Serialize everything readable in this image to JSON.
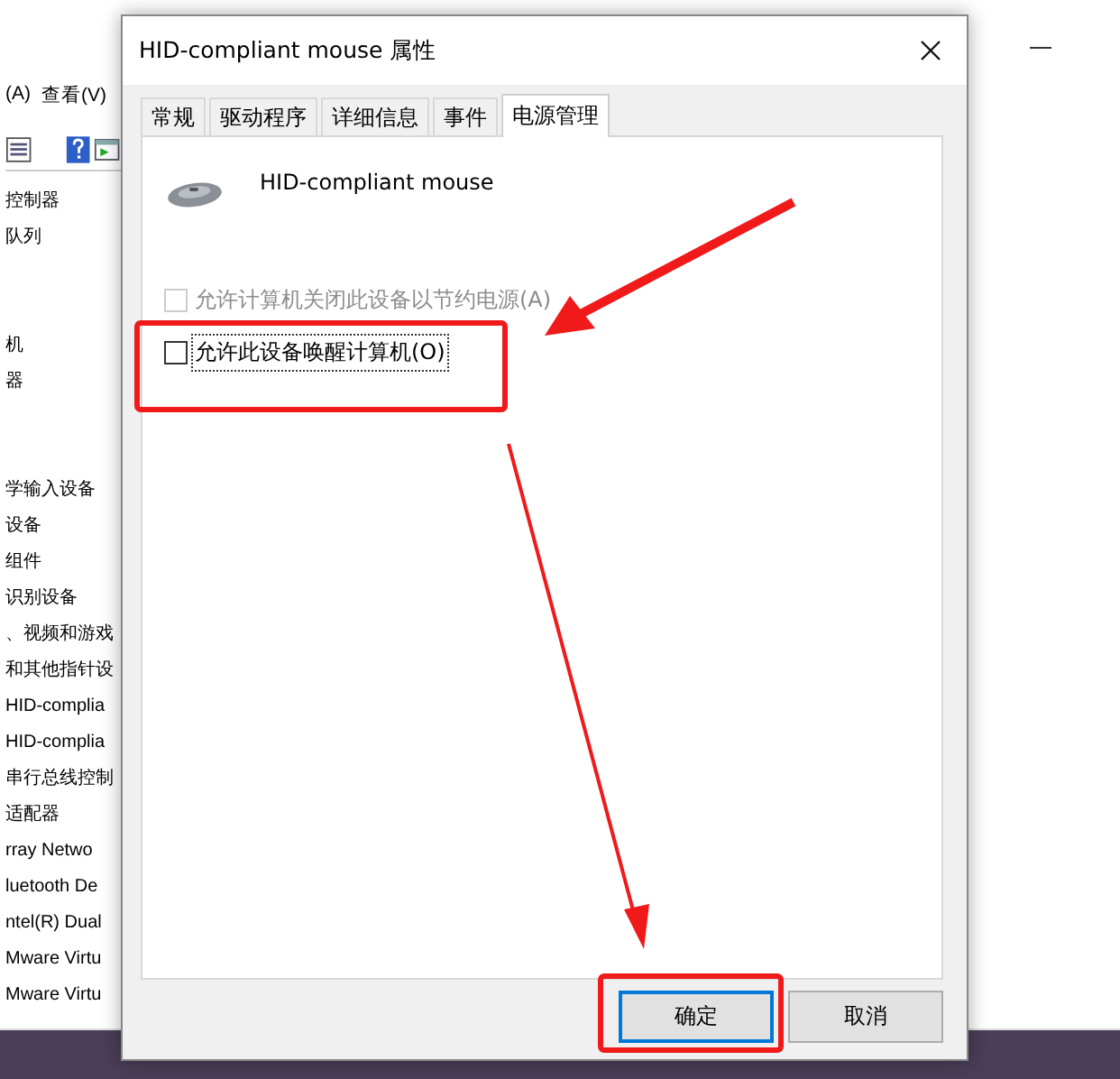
{
  "background_window": {
    "menu": [
      "(A)",
      "查看(V)"
    ],
    "tree_groups": [
      [
        "控制器",
        "队列"
      ],
      [
        "机",
        "器"
      ],
      [
        "学输入设备",
        "设备",
        "组件",
        "识别设备",
        "、视频和游戏",
        "和其他指针设",
        "HID-complia",
        "HID-complia",
        "串行总线控制",
        "适配器",
        "rray Netwo",
        "luetooth De",
        "ntel(R) Dual",
        "Mware Virtu",
        "Mware Virtu"
      ]
    ]
  },
  "dialog": {
    "title": "HID-compliant mouse 属性",
    "tabs": [
      {
        "label": "常规",
        "selected": false
      },
      {
        "label": "驱动程序",
        "selected": false
      },
      {
        "label": "详细信息",
        "selected": false
      },
      {
        "label": "事件",
        "selected": false
      },
      {
        "label": "电源管理",
        "selected": true
      }
    ],
    "device_name": "HID-compliant mouse",
    "options": [
      {
        "label": "允许计算机关闭此设备以节约电源(A)",
        "checked": false,
        "disabled": true,
        "focused": false
      },
      {
        "label": "允许此设备唤醒计算机(O)",
        "checked": false,
        "disabled": false,
        "focused": true
      }
    ],
    "buttons": [
      {
        "label": "确定",
        "default": true
      },
      {
        "label": "取消",
        "default": false
      }
    ]
  }
}
